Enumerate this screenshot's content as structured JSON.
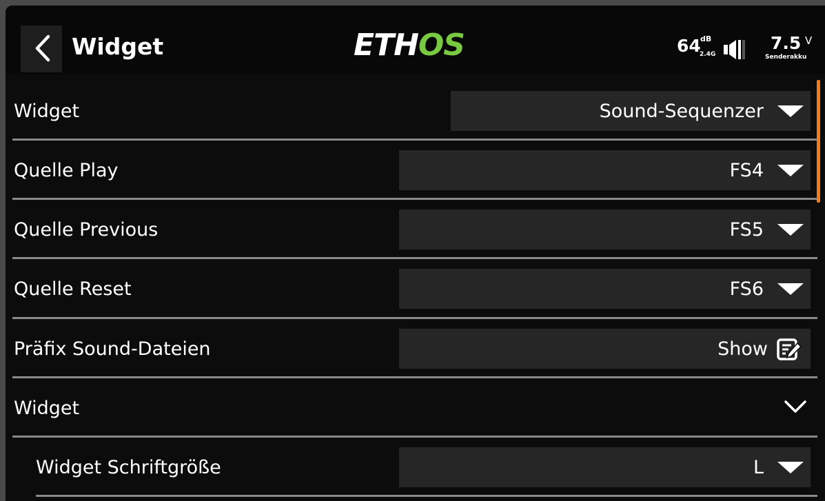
{
  "header": {
    "title": "Widget",
    "logo_part1": "ETH",
    "logo_part2": "OS",
    "rssi_value": "64",
    "rssi_unit": "dB",
    "rssi_band": "2.4G",
    "voltage_value": "7.5",
    "voltage_unit": "V",
    "voltage_label": "Senderakku"
  },
  "rows": [
    {
      "label": "Widget",
      "value": "Sound-Sequenzer",
      "control": "dropdown"
    },
    {
      "label": "Quelle Play",
      "value": "FS4",
      "control": "dropdown"
    },
    {
      "label": "Quelle Previous",
      "value": "FS5",
      "control": "dropdown"
    },
    {
      "label": "Quelle Reset",
      "value": "FS6",
      "control": "dropdown"
    },
    {
      "label": "Präfix Sound-Dateien",
      "value": "Show",
      "control": "edit"
    },
    {
      "label": "Widget",
      "control": "expander"
    },
    {
      "label": "Widget Schriftgröße",
      "value": "L",
      "control": "dropdown"
    }
  ],
  "colors": {
    "accent_green": "#7ac943",
    "scrollbar": "#f07d1a",
    "background": "#0c0c0c",
    "field": "#262626"
  },
  "icons": [
    "back-icon",
    "signal-icon",
    "dropdown-arrow-icon",
    "edit-icon",
    "chevron-down-icon"
  ]
}
